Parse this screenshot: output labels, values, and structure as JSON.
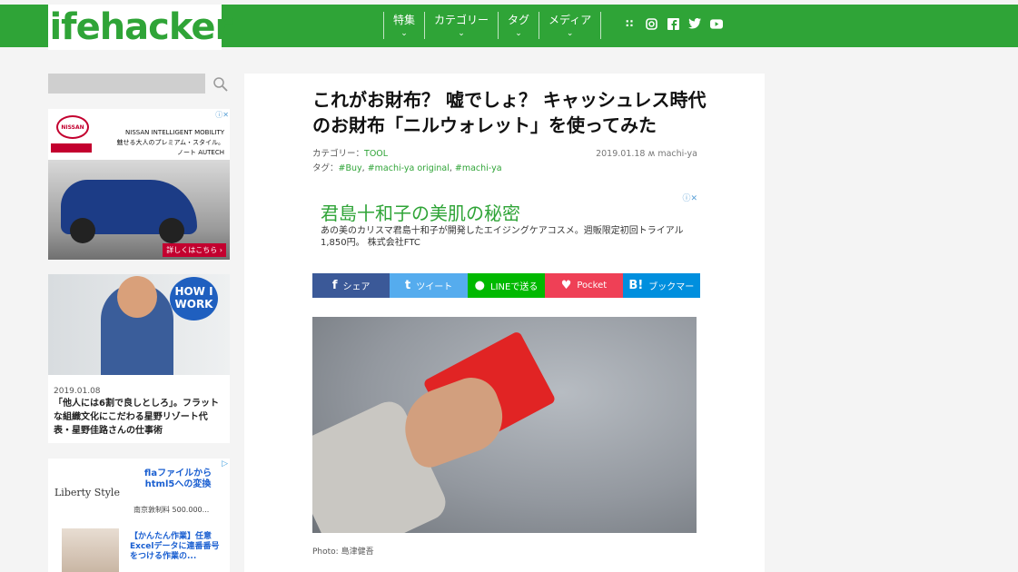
{
  "header": {
    "logo": "lifehacker",
    "nav": [
      {
        "label": "特集"
      },
      {
        "label": "カテゴリー"
      },
      {
        "label": "タグ"
      },
      {
        "label": "メディア"
      }
    ],
    "social_icons": [
      "rss-icon",
      "instagram-icon",
      "facebook-icon",
      "twitter-icon",
      "youtube-icon"
    ]
  },
  "sidebar": {
    "search": {
      "value": "",
      "placeholder": ""
    },
    "ad1": {
      "brand": "NISSAN",
      "line1": "NISSAN INTELLIGENT MOBILITY",
      "line2": "魅せる大人のプレミアム・スタイル。",
      "line3": "ノート AUTECH",
      "cta": "詳しくはこちら ›"
    },
    "card": {
      "badge_line1": "HOW I",
      "badge_line2": "WORK",
      "date": "2019.01.08",
      "title": "「他人には6割で良しとしろ」。フラットな組織文化にこだわる星野リゾート代表・星野佳路さんの仕事術"
    },
    "ad3": {
      "brand": "Liberty Style",
      "link1": "flaファイルからhtml5への変換",
      "publisher": "南京敦制料 500.000...",
      "link2": "【かんたん作業】任意Excelデータに連番番号をつける作業の..."
    }
  },
  "article": {
    "title": "これがお財布？ 嘘でしょ？ キャッシュレス時代のお財布「ニルウォレット」を使ってみた",
    "category_label": "カテゴリー：",
    "category": "TOOL",
    "tags_label": "タグ：",
    "tags": [
      "#Buy",
      "#machi-ya original",
      "#machi-ya"
    ],
    "date": "2019.01.18",
    "author": "machi-ya",
    "ad": {
      "heading": "君島十和子の美肌の秘密",
      "desc": "あの美のカリスマ君島十和子が開発したエイジングケアコスメ。週販限定初回トライアル1,850円。 株式会社FTC"
    },
    "share": [
      {
        "label": "シェア",
        "glyph": "f",
        "color": "#3b5998"
      },
      {
        "label": "ツイート",
        "glyph": "t",
        "color": "#55acee"
      },
      {
        "label": "LINEで送る",
        "glyph": "●",
        "color": "#00b900"
      },
      {
        "label": "Pocket",
        "glyph": "♥",
        "color": "#ef4056"
      },
      {
        "label": "ブックマー",
        "glyph": "B!",
        "color": "#008fde"
      }
    ],
    "caption": "Photo: 島津健吾"
  }
}
